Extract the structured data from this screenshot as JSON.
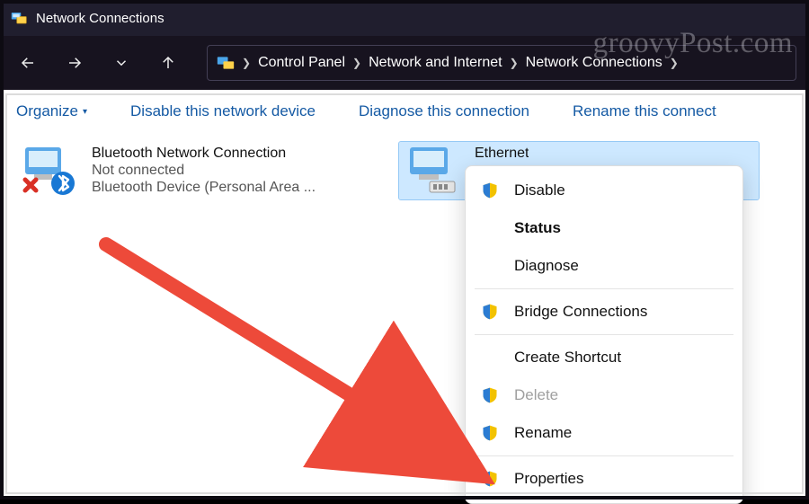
{
  "watermark": "groovyPost.com",
  "title": "Network Connections",
  "breadcrumbs": [
    "Control Panel",
    "Network and Internet",
    "Network Connections"
  ],
  "toolbar": {
    "organize": "Organize",
    "disable": "Disable this network device",
    "diagnose": "Diagnose this connection",
    "rename": "Rename this connect"
  },
  "connections": [
    {
      "name": "Bluetooth Network Connection",
      "status": "Not connected",
      "device": "Bluetooth Device (Personal Area ...",
      "selected": false,
      "icon": "bluetooth"
    },
    {
      "name": "Ethernet",
      "status": "",
      "device": "",
      "selected": true,
      "icon": "ethernet"
    }
  ],
  "context_menu": {
    "disable": {
      "label": "Disable",
      "shield": true
    },
    "status": {
      "label": "Status",
      "shield": false,
      "bold": true
    },
    "diagnose": {
      "label": "Diagnose",
      "shield": false
    },
    "bridge": {
      "label": "Bridge Connections",
      "shield": true
    },
    "shortcut": {
      "label": "Create Shortcut",
      "shield": false
    },
    "delete": {
      "label": "Delete",
      "shield": true,
      "disabled": true
    },
    "rename": {
      "label": "Rename",
      "shield": true
    },
    "properties": {
      "label": "Properties",
      "shield": true
    }
  }
}
